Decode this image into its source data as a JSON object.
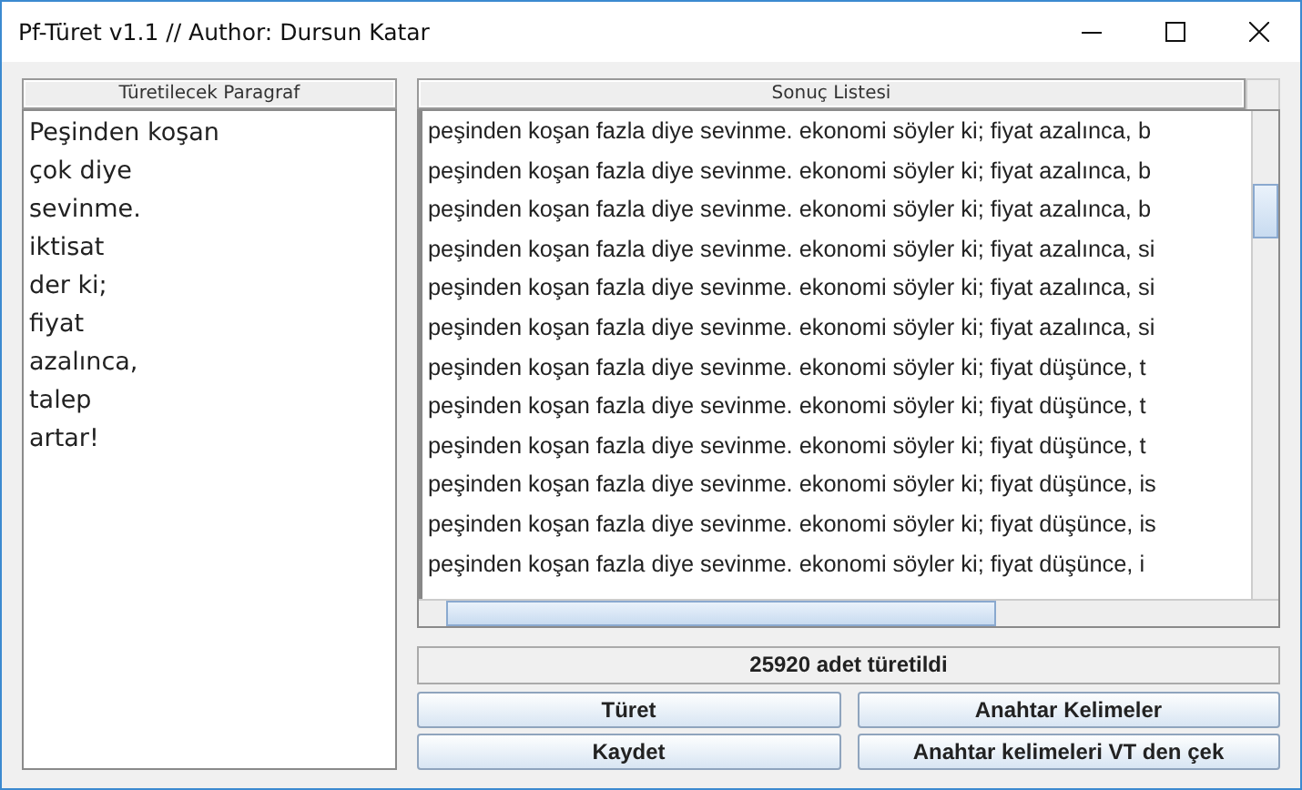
{
  "window": {
    "title": "Pf-Türet v1.1 // Author: Dursun Katar"
  },
  "input_panel": {
    "header": "Türetilecek Paragraf",
    "lines": [
      "Peşinden koşan",
      "çok diye",
      "sevinme.",
      "iktisat",
      "der ki;",
      "fiyat",
      "azalınca,",
      "talep",
      "artar!"
    ]
  },
  "result_panel": {
    "header": "Sonuç Listesi",
    "rows": [
      "peşinden koşan fazla diye sevinme. ekonomi söyler ki; fiyat azalınca, b",
      "peşinden koşan fazla diye sevinme. ekonomi söyler ki; fiyat azalınca, b",
      "peşinden koşan fazla diye sevinme. ekonomi söyler ki; fiyat azalınca, b",
      "peşinden koşan fazla diye sevinme. ekonomi söyler ki; fiyat azalınca, si",
      "peşinden koşan fazla diye sevinme. ekonomi söyler ki; fiyat azalınca, si",
      "peşinden koşan fazla diye sevinme. ekonomi söyler ki; fiyat azalınca, si",
      "peşinden koşan fazla diye sevinme. ekonomi söyler ki; fiyat düşünce, t",
      "peşinden koşan fazla diye sevinme. ekonomi söyler ki; fiyat düşünce, t",
      "peşinden koşan fazla diye sevinme. ekonomi söyler ki; fiyat düşünce, t",
      "peşinden koşan fazla diye sevinme. ekonomi söyler ki; fiyat düşünce, is",
      "peşinden koşan fazla diye sevinme. ekonomi söyler ki; fiyat düşünce, is",
      "peşinden koşan fazla diye sevinme. ekonomi söyler ki; fiyat düşünce, i"
    ]
  },
  "status": "25920  adet türetildi",
  "buttons": [
    "Türet",
    "Anahtar Kelimeler",
    "Kaydet",
    "Anahtar kelimeleri VT den çek"
  ]
}
